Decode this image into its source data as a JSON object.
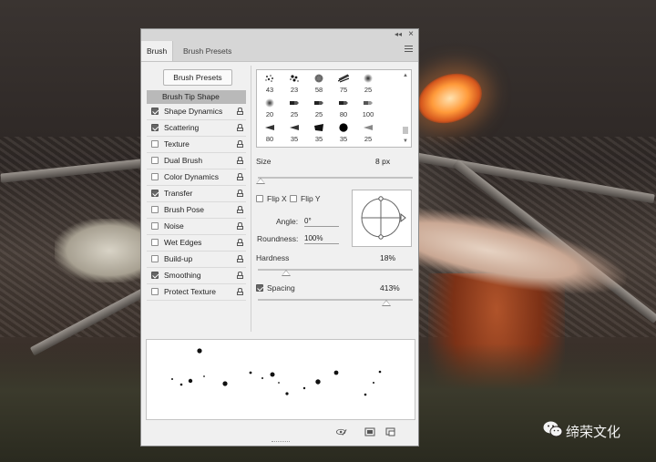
{
  "panel": {
    "tabs": [
      "Brush",
      "Brush Presets"
    ],
    "collapse_glyph": "◂◂",
    "close_glyph": "×",
    "brush_presets_button": "Brush Presets"
  },
  "options": {
    "header": "Brush Tip Shape",
    "items": [
      {
        "label": "Shape Dynamics",
        "checked": true,
        "lock": true
      },
      {
        "label": "Scattering",
        "checked": true,
        "lock": true
      },
      {
        "label": "Texture",
        "checked": false,
        "lock": true
      },
      {
        "label": "Dual Brush",
        "checked": false,
        "lock": true
      },
      {
        "label": "Color Dynamics",
        "checked": false,
        "lock": true
      },
      {
        "label": "Transfer",
        "checked": true,
        "lock": true
      },
      {
        "label": "Brush Pose",
        "checked": false,
        "lock": true
      },
      {
        "label": "Noise",
        "checked": false,
        "lock": true
      },
      {
        "label": "Wet Edges",
        "checked": false,
        "lock": true
      },
      {
        "label": "Build-up",
        "checked": false,
        "lock": true
      },
      {
        "label": "Smoothing",
        "checked": true,
        "lock": true
      },
      {
        "label": "Protect Texture",
        "checked": false,
        "lock": true
      }
    ]
  },
  "brush_tips": [
    {
      "size": "43",
      "kind": "splatter"
    },
    {
      "size": "23",
      "kind": "splatter-dark"
    },
    {
      "size": "58",
      "kind": "texture-round"
    },
    {
      "size": "75",
      "kind": "streaks"
    },
    {
      "size": "25",
      "kind": "soft-round"
    },
    {
      "size": "20",
      "kind": "soft-round-large"
    },
    {
      "size": "25",
      "kind": "chisel"
    },
    {
      "size": "25",
      "kind": "chisel"
    },
    {
      "size": "80",
      "kind": "chisel"
    },
    {
      "size": "100",
      "kind": "chisel-light"
    },
    {
      "size": "80",
      "kind": "flat"
    },
    {
      "size": "35",
      "kind": "flat"
    },
    {
      "size": "35",
      "kind": "flat-dark"
    },
    {
      "size": "35",
      "kind": "hard-round"
    },
    {
      "size": "25",
      "kind": "flat-light"
    }
  ],
  "tip_shape": {
    "size_label": "Size",
    "size_value": "8 px",
    "size_fraction": 0.02,
    "flip_x_label": "Flip X",
    "flip_y_label": "Flip Y",
    "flip_x": false,
    "flip_y": false,
    "angle_label": "Angle:",
    "angle_value": "0°",
    "roundness_label": "Roundness:",
    "roundness_value": "100%",
    "hardness_label": "Hardness",
    "hardness_value": "18%",
    "hardness_fraction": 0.18,
    "spacing_label": "Spacing",
    "spacing_checked": true,
    "spacing_value": "413%",
    "spacing_fraction": 0.83
  },
  "footer_icons": [
    "eye-brush-icon",
    "new-preset-icon",
    "create-brush-icon"
  ],
  "watermark": {
    "text": "缔荣文化"
  }
}
